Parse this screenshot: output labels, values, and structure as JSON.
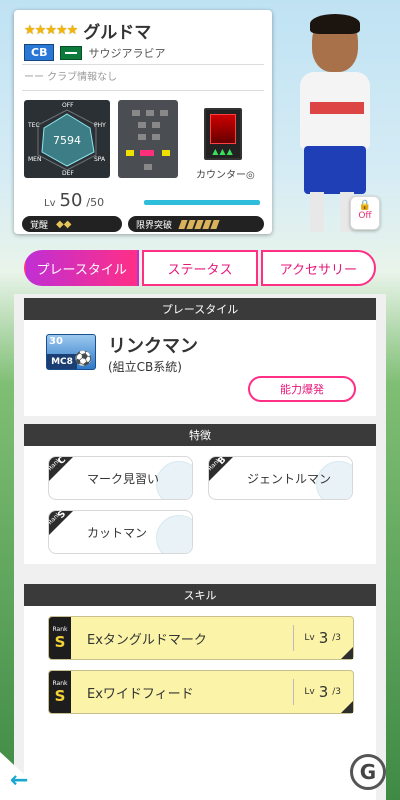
{
  "player": {
    "stars": "★★★★★",
    "name": "グルドマ",
    "position": "CB",
    "country": "サウジアラビア",
    "club": "ーー クラブ情報なし",
    "rating": "7594",
    "radar_labels": [
      "OFF",
      "TEC",
      "PHY",
      "MEN",
      "SPA",
      "DEF"
    ],
    "counter_label": "カウンター◎",
    "level_label": "Lv",
    "level": "50",
    "level_max": "/50",
    "level_progress": 1.0,
    "awakening_label": "覚醒",
    "awakening_icon": "◆◆",
    "limit_break_label": "限界突破",
    "lock_label": "Off"
  },
  "tabs": [
    {
      "label": "プレースタイル",
      "active": true
    },
    {
      "label": "ステータス",
      "active": false
    },
    {
      "label": "アクセサリー",
      "active": false
    }
  ],
  "playstyle": {
    "header": "プレースタイル",
    "icon_level": "30",
    "icon_code": "MC8",
    "name": "リンクマン",
    "subtitle": "(組立CB系統)",
    "burst_button": "能力爆発"
  },
  "traits": {
    "header": "特徴",
    "rank_prefix": "Rank",
    "items": [
      {
        "rank": "C",
        "label": "マーク見習い"
      },
      {
        "rank": "B",
        "label": "ジェントルマン"
      },
      {
        "rank": "S",
        "label": "カットマン"
      }
    ]
  },
  "skills": {
    "header": "スキル",
    "rank_prefix": "Rank",
    "items": [
      {
        "rank": "S",
        "name": "Exタングルドマーク",
        "lv_label": "Lv",
        "lv": "3",
        "lv_max": "/3"
      },
      {
        "rank": "S",
        "name": "Exワイドフィード",
        "lv_label": "Lv",
        "lv": "3",
        "lv_max": "/3"
      }
    ]
  },
  "nav": {
    "back_icon": "←"
  },
  "colors": {
    "accent": "#ff2f86",
    "tab_gradient": [
      "#c02fd4",
      "#ff2f86"
    ],
    "position_badge": "#2a78d6",
    "skill_bg": "#fbf4a8"
  }
}
